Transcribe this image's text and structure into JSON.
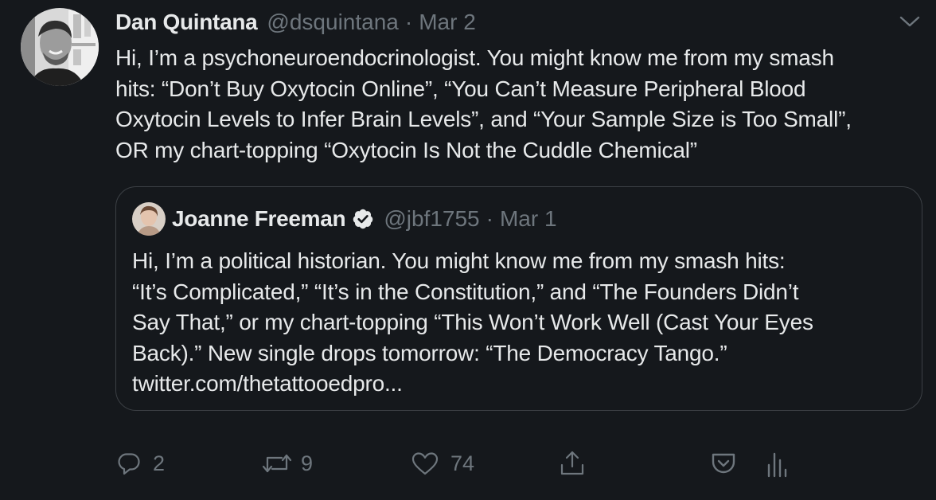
{
  "tweet": {
    "author_name": "Dan Quintana",
    "author_handle": "@dsquintana",
    "separator": "·",
    "date": "Mar 2",
    "text": "Hi, I’m a psychoneuroendocrinologist. You might know me from my smash\nhits: “Don’t Buy Oxytocin Online”, “You Can’t Measure Peripheral Blood\nOxytocin Levels to Infer Brain Levels”, and “Your Sample Size is Too Small”,\nOR my chart-topping “Oxytocin Is Not the Cuddle Chemical”"
  },
  "quoted_tweet": {
    "author_name": "Joanne Freeman",
    "author_handle": "@jbf1755",
    "separator": "·",
    "date": "Mar 1",
    "verified": true,
    "text": "Hi, I’m a political historian. You might know me from my smash hits:\n“It’s Complicated,” “It’s in the Constitution,” and “The Founders Didn’t\nSay That,” or my chart-topping “This Won’t Work Well (Cast Your Eyes\nBack).” New single drops tomorrow: “The Democracy Tango.”\ntwitter.com/thetattooedpro..."
  },
  "actions": {
    "reply_count": "2",
    "retweet_count": "9",
    "like_count": "74"
  },
  "icons": {
    "menu": "chevron-down-icon",
    "reply": "reply-icon",
    "retweet": "retweet-icon",
    "like": "heart-icon",
    "share": "share-icon",
    "save": "pocket-icon",
    "analytics": "analytics-icon",
    "verified": "verified-badge-icon"
  },
  "colors": {
    "background": "#15181c",
    "text": "#e7e9ea",
    "muted": "#6e767d",
    "border": "#3c4045",
    "verified_badge": "#e7e9ea"
  }
}
